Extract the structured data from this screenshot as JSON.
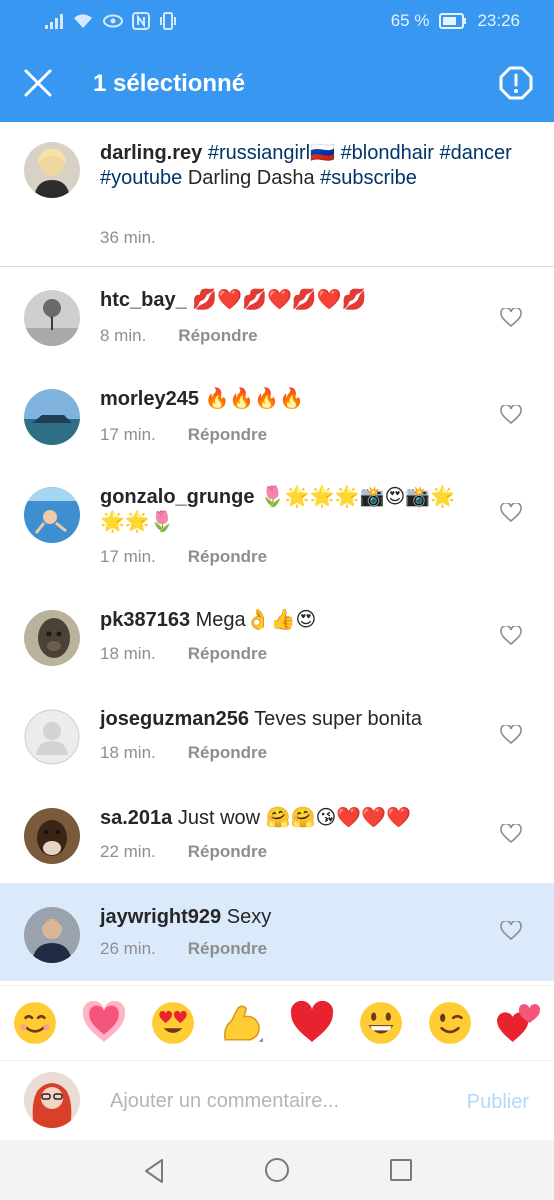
{
  "status_bar": {
    "battery": "65 %",
    "time": "23:26"
  },
  "app_bar": {
    "title": "1 sélectionné"
  },
  "caption": {
    "username": "darling.rey",
    "tag_russiangirl": "#russiangirl",
    "flag": "🇷🇺",
    "tag_blondhair": "#blondhair",
    "tag_dancer": "#dancer",
    "tag_youtube": "#youtube",
    "plain_text": "Darling Dasha",
    "tag_subscribe": "#subscribe",
    "time": "36 min."
  },
  "comments": [
    {
      "username": "htc_bay_",
      "text": "💋❤️💋❤️💋❤️💋",
      "time": "8 min.",
      "reply": "Répondre"
    },
    {
      "username": "morley245",
      "text": "🔥🔥🔥🔥",
      "time": "17 min.",
      "reply": "Répondre"
    },
    {
      "username": "gonzalo_grunge",
      "text": "🌷🌟🌟🌟📸😍📸🌟🌟🌟🌷",
      "time": "17 min.",
      "reply": "Répondre"
    },
    {
      "username": "pk387163",
      "text": "Mega👌👍😍",
      "time": "18 min.",
      "reply": "Répondre"
    },
    {
      "username": "joseguzman256",
      "text": "Teves super bonita",
      "time": "18 min.",
      "reply": "Répondre"
    },
    {
      "username": "sa.201a",
      "text": "Just wow 🤗🤗😘❤️❤️❤️",
      "time": "22 min.",
      "reply": "Répondre"
    },
    {
      "username": "jaywright929",
      "text": "Sexy",
      "time": "26 min.",
      "reply": "Répondre"
    }
  ],
  "emoji_bar": [
    "😊",
    "💗",
    "😍",
    "💪",
    "❤️",
    "😃",
    "😉",
    "💕"
  ],
  "composer": {
    "placeholder": "Ajouter un commentaire...",
    "publish_label": "Publier"
  },
  "colors": {
    "accent": "#3897f0",
    "hashtag": "#003569",
    "selected_row": "#dbeafb",
    "muted": "#8e8e8e"
  }
}
